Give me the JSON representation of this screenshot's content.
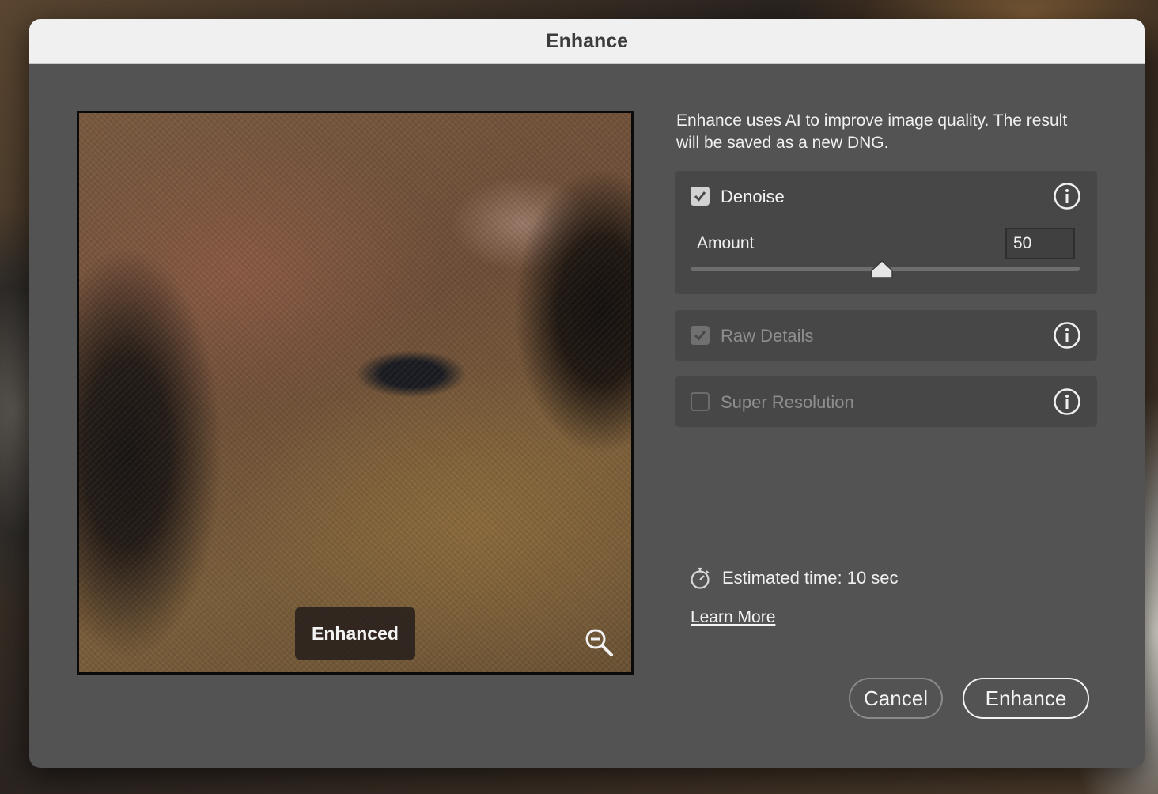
{
  "dialog": {
    "title": "Enhance"
  },
  "preview": {
    "tag_label": "Enhanced",
    "zoom_icon": "zoom-out-icon"
  },
  "description": "Enhance uses AI to improve image quality. The result will be saved as a new DNG.",
  "options": {
    "denoise": {
      "label": "Denoise",
      "checked": true,
      "enabled": true,
      "info_icon": "info-icon"
    },
    "amount": {
      "label": "Amount",
      "value": "50",
      "slider_percent": 50
    },
    "raw_details": {
      "label": "Raw Details",
      "checked": true,
      "enabled": false,
      "info_icon": "info-icon"
    },
    "super_resolution": {
      "label": "Super Resolution",
      "checked": false,
      "enabled": true,
      "info_icon": "info-icon"
    }
  },
  "estimate": {
    "icon": "stopwatch-icon",
    "text": "Estimated time: 10 sec"
  },
  "learn_more": "Learn More",
  "buttons": {
    "cancel": "Cancel",
    "enhance": "Enhance"
  },
  "colors": {
    "dialog_bg": "#535353",
    "panel_bg": "#474747",
    "titlebar_bg": "#f0f0f0"
  }
}
